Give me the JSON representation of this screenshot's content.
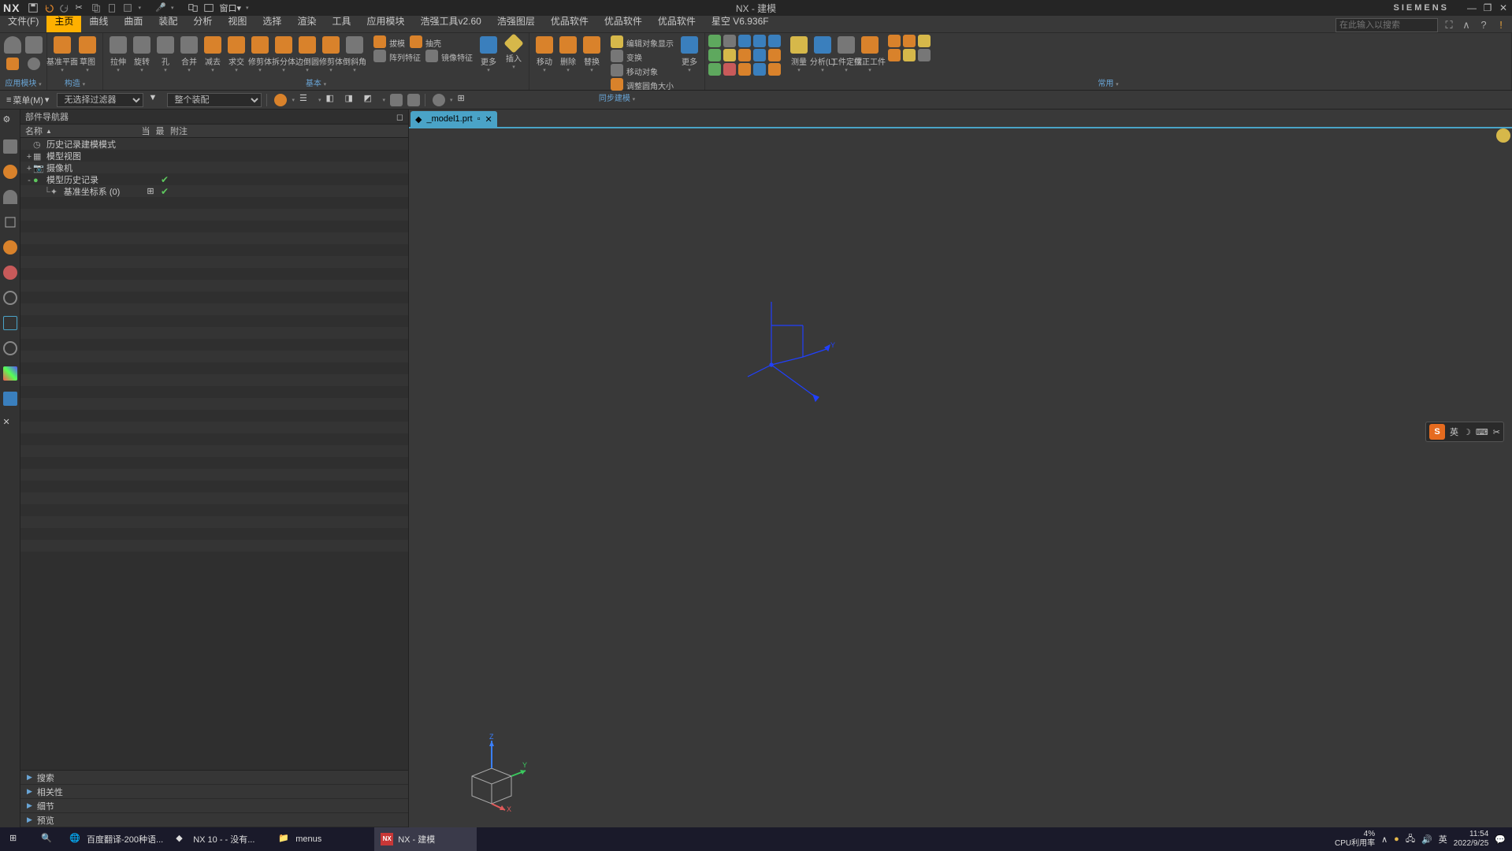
{
  "title": "NX - 建模",
  "brand": "SIEMENS",
  "logo": "NX",
  "menus": [
    "文件(F)",
    "主页",
    "曲线",
    "曲面",
    "装配",
    "分析",
    "视图",
    "选择",
    "渲染",
    "工具",
    "应用模块",
    "浩强工具v2.60",
    "浩强图层",
    "优品软件",
    "优品软件",
    "优品软件",
    "星空 V6.936F"
  ],
  "active_menu": 1,
  "search_placeholder": "在此输入以搜索",
  "ribbon": {
    "groups": [
      {
        "label": "构造",
        "buttons": [
          {
            "l": "基准平面",
            "c": "c-or"
          },
          {
            "l": "草图",
            "c": "c-or"
          }
        ]
      },
      {
        "label": "基本",
        "buttons": [
          {
            "l": "拉伸",
            "c": "c-gy"
          },
          {
            "l": "旋转",
            "c": "c-gy"
          },
          {
            "l": "孔",
            "c": "c-gy"
          },
          {
            "l": "合并",
            "c": "c-gy"
          },
          {
            "l": "减去",
            "c": "c-or"
          },
          {
            "l": "求交",
            "c": "c-or"
          },
          {
            "l": "修剪体",
            "c": "c-or"
          },
          {
            "l": "拆分体",
            "c": "c-or"
          },
          {
            "l": "边倒圆",
            "c": "c-or"
          },
          {
            "l": "修剪体",
            "c": "c-or"
          },
          {
            "l": "倒斜角",
            "c": "c-gy"
          }
        ],
        "side": [
          {
            "l": "拔模",
            "c": "c-or"
          },
          {
            "l": "抽壳",
            "c": "c-or"
          },
          {
            "l": "阵列特征",
            "c": "c-gy"
          },
          {
            "l": "镜像特征",
            "c": "c-gy"
          }
        ],
        "more": {
          "l": "更多",
          "c": "c-bl"
        },
        "insert": {
          "l": "插入",
          "c": "c-yl"
        }
      },
      {
        "label": "同步建模",
        "buttons": [
          {
            "l": "移动",
            "c": "c-or"
          },
          {
            "l": "删除",
            "c": "c-or"
          },
          {
            "l": "替换",
            "c": "c-or"
          }
        ],
        "side": [
          {
            "l": "编辑对象显示",
            "c": "c-yl"
          },
          {
            "l": "变换",
            "c": "c-gy"
          },
          {
            "l": "移动对象",
            "c": "c-gy"
          },
          {
            "l": "调整圆角大小",
            "c": "c-or"
          }
        ],
        "more": {
          "l": "更多",
          "c": "c-bl"
        }
      },
      {
        "label": "常用",
        "buttons": [],
        "grid3x3": [
          [
            "c-gn",
            "c-gy",
            "c-bl",
            "c-bl",
            "c-bl"
          ],
          [
            "c-gn",
            "c-yl",
            "c-or",
            "c-bl",
            "c-or"
          ],
          [
            "c-gn",
            "c-rd",
            "c-or",
            "c-bl",
            "c-or"
          ]
        ],
        "big": [
          {
            "l": "测量",
            "c": "c-yl"
          },
          {
            "l": "分析(L)",
            "c": "c-bl"
          },
          {
            "l": "工件定位",
            "c": "c-gy"
          },
          {
            "l": "摆正工件",
            "c": "c-or"
          }
        ],
        "tail": [
          [
            "c-or",
            "c-or",
            "c-yl"
          ],
          [
            "c-or",
            "c-yl",
            "c-gy"
          ]
        ]
      }
    ]
  },
  "selbar": {
    "menu_label": "菜单(M)",
    "filter": "无选择过滤器",
    "scope": "整个装配"
  },
  "navigator": {
    "title": "部件导航器",
    "headers": {
      "name": "名称",
      "cur": "当",
      "qty": "最",
      "note": "附注"
    },
    "rows": [
      {
        "indent": 0,
        "exp": "",
        "ico": "clock",
        "label": "历史记录建模模式",
        "chk": ""
      },
      {
        "indent": 0,
        "exp": "+",
        "ico": "view",
        "label": "模型视图",
        "chk": ""
      },
      {
        "indent": 0,
        "exp": "+",
        "ico": "cam",
        "label": "摄像机",
        "chk": ""
      },
      {
        "indent": 0,
        "exp": "-",
        "ico": "hist",
        "label": "模型历史记录",
        "chk": "✔",
        "chk2": ""
      },
      {
        "indent": 1,
        "exp": "",
        "ico": "csys",
        "label": "基准坐标系 (0)",
        "chk": "✔",
        "chk2": "⊞"
      }
    ],
    "panels": [
      "搜索",
      "相关性",
      "细节",
      "预览"
    ]
  },
  "tab": {
    "label": "_model1.prt"
  },
  "ime": {
    "s": "S",
    "lang": "英"
  },
  "taskbar": {
    "items": [
      {
        "ico": "win",
        "label": ""
      },
      {
        "ico": "search",
        "label": ""
      },
      {
        "ico": "edge",
        "label": "百度翻译-200种语..."
      },
      {
        "ico": "nx",
        "label": "NX 10 -   - 没有..."
      },
      {
        "ico": "folder",
        "label": "menus"
      },
      {
        "ico": "nx2",
        "label": "NX - 建模",
        "active": true
      }
    ],
    "tray": {
      "cpu_pct": "4%",
      "cpu_lbl": "CPU利用率",
      "lang": "英",
      "time": "11:54",
      "date": "2022/9/25"
    }
  }
}
